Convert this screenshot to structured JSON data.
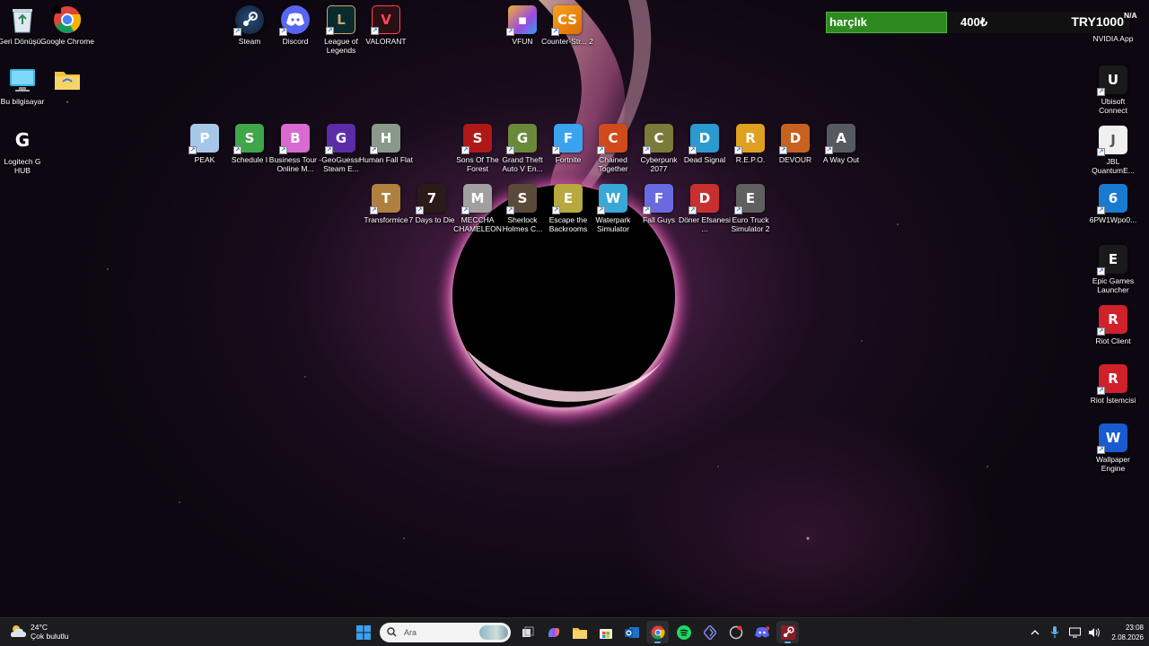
{
  "desktop": {
    "left_column": [
      {
        "label": "Geri Dönüşü...",
        "icon": "recycle-bin-icon"
      },
      {
        "label": "Google Chrome",
        "icon": "chrome-icon"
      },
      {
        "label": "Bu bilgisayar",
        "icon": "this-pc-icon"
      },
      {
        "label": "-",
        "icon": "folder-icon"
      },
      {
        "label": "Logitech G HUB",
        "icon": "logitech-g-icon"
      }
    ],
    "top_row": [
      {
        "label": "Steam",
        "icon": "steam-icon"
      },
      {
        "label": "Discord",
        "icon": "discord-icon"
      },
      {
        "label": "League of Legends",
        "icon": "league-of-legends-icon"
      },
      {
        "label": "VALORANT",
        "icon": "valorant-icon"
      },
      {
        "label": "VFUN",
        "icon": "vfun-icon"
      },
      {
        "label": "Counter-Str... 2",
        "icon": "counter-strike-icon"
      }
    ],
    "row1": [
      {
        "label": "PEAK",
        "icon": "peak-icon",
        "color": "#a7c7e8"
      },
      {
        "label": "Schedule I",
        "icon": "schedule-i-icon",
        "color": "#3fa64a"
      },
      {
        "label": "Business Tour - Online M...",
        "icon": "business-tour-icon",
        "color": "#d86ad0"
      },
      {
        "label": "GeoGuessr Steam E...",
        "icon": "geoguessr-icon",
        "color": "#5b2ca8"
      },
      {
        "label": "Human Fall Flat",
        "icon": "human-fall-flat-icon",
        "color": "#8a9a8a"
      },
      {
        "label": "Sons Of The Forest",
        "icon": "sons-of-the-forest-icon",
        "color": "#b01818"
      },
      {
        "label": "Grand Theft Auto V En...",
        "icon": "gta-v-icon",
        "color": "#6a8a3a"
      },
      {
        "label": "Fortnite",
        "icon": "fortnite-icon",
        "color": "#3aa3f0"
      },
      {
        "label": "Chained Together",
        "icon": "chained-together-icon",
        "color": "#d04a1a"
      },
      {
        "label": "Cyberpunk 2077",
        "icon": "cyberpunk-icon",
        "color": "#7a7a3a"
      },
      {
        "label": "Dead Signal",
        "icon": "dead-signal-icon",
        "color": "#2a9ad0"
      },
      {
        "label": "R.E.P.O.",
        "icon": "repo-icon",
        "color": "#e0a020"
      },
      {
        "label": "DEVOUR",
        "icon": "devour-icon",
        "color": "#c86020"
      },
      {
        "label": "A Way Out",
        "icon": "a-way-out-icon",
        "color": "#555a60"
      }
    ],
    "row2": [
      {
        "label": "Transformice",
        "icon": "transformice-icon",
        "color": "#b08040"
      },
      {
        "label": "7 Days to Die",
        "icon": "7-days-to-die-icon",
        "color": "#2a1a1a"
      },
      {
        "label": "MECCHA CHAMELEON",
        "icon": "meccha-chameleon-icon",
        "color": "#a0a0a0"
      },
      {
        "label": "Sherlock Holmes C...",
        "icon": "sherlock-holmes-icon",
        "color": "#5a4a3a"
      },
      {
        "label": "Escape the Backrooms",
        "icon": "escape-the-backrooms-icon",
        "color": "#b8a840"
      },
      {
        "label": "Waterpark Simulator",
        "icon": "waterpark-simulator-icon",
        "color": "#38a8d8"
      },
      {
        "label": "Fall Guys",
        "icon": "fall-guys-icon",
        "color": "#6a6ae0"
      },
      {
        "label": "Döner Efsanesi ...",
        "icon": "doner-efsanesi-icon",
        "color": "#c83030"
      },
      {
        "label": "Euro Truck Simulator 2",
        "icon": "euro-truck-simulator-icon",
        "color": "#606060"
      }
    ],
    "right_column": [
      {
        "label": "NVIDIA App",
        "icon": "nvidia-icon"
      },
      {
        "label": "Ubisoft Connect",
        "icon": "ubisoft-icon"
      },
      {
        "label": "JBL QuantumE...",
        "icon": "jbl-icon"
      },
      {
        "label": "6PW1Wpo0...",
        "icon": "edge-icon"
      },
      {
        "label": "Epic Games Launcher",
        "icon": "epic-games-icon"
      },
      {
        "label": "Riot Client",
        "icon": "riot-client-icon"
      },
      {
        "label": "Riot İstemcisi",
        "icon": "riot-client-icon"
      },
      {
        "label": "Wallpaper Engine",
        "icon": "wallpaper-engine-icon"
      }
    ]
  },
  "overlay": {
    "title": "harçlık",
    "current": "400₺",
    "goal": "TRY1000",
    "progress": 0.4,
    "na": "N/A"
  },
  "taskbar": {
    "weather_temp": "24°C",
    "weather_desc": "Çok bulutlu",
    "search_placeholder": "Ara",
    "time": "23:08",
    "date": "2.08.2026",
    "pinned": [
      "start-icon",
      "search",
      "task-view-icon",
      "copilot-icon",
      "file-explorer-icon",
      "store-icon",
      "outlook-icon",
      "chrome-icon",
      "spotify-icon",
      "proton-vpn-icon",
      "app-icon",
      "discord-icon",
      "steam-icon"
    ]
  }
}
